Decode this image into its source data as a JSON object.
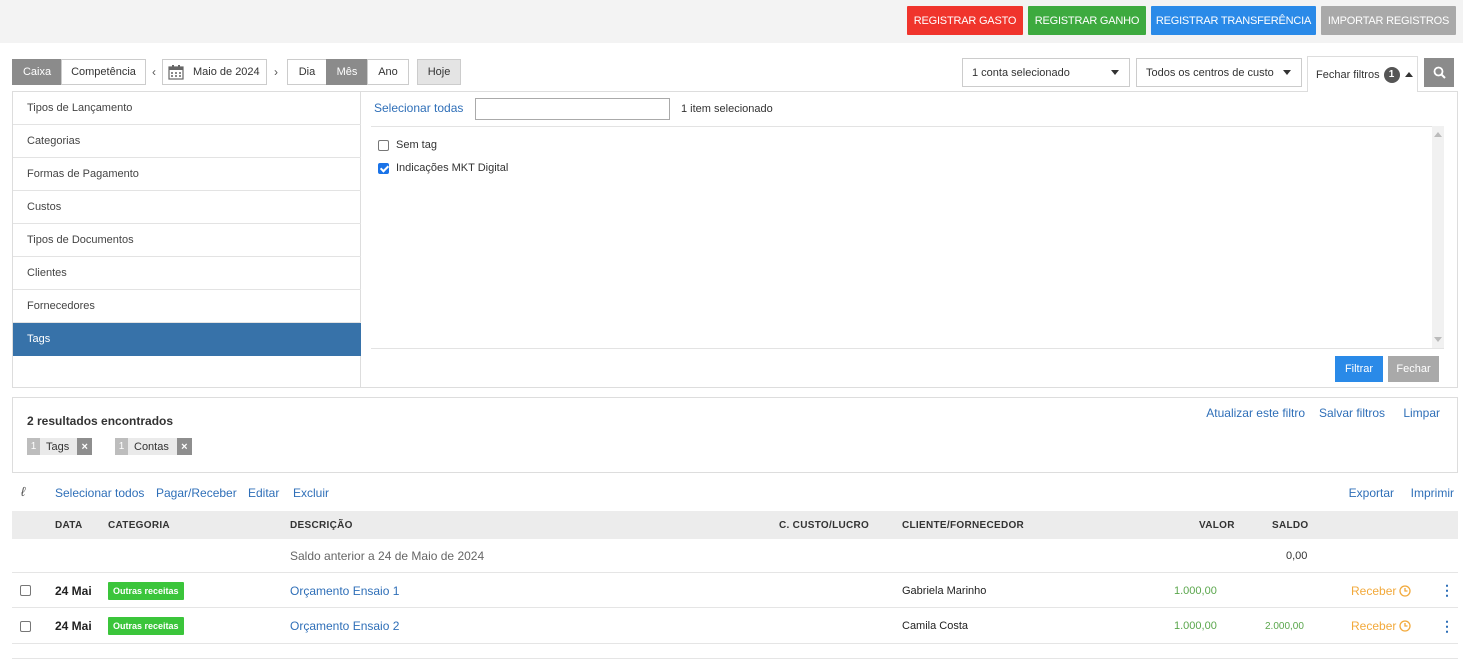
{
  "topbar": {
    "buttons": [
      {
        "label": "REGISTRAR GASTO",
        "color": "#f0342c"
      },
      {
        "label": "REGISTRAR GANHO",
        "color": "#3daa3f"
      },
      {
        "label": "REGISTRAR TRANSFERÊNCIA",
        "color": "#2a8ae8"
      },
      {
        "label": "IMPORTAR REGISTROS",
        "color": "#a9a9a9"
      }
    ]
  },
  "controls": {
    "mode": {
      "caixa": "Caixa",
      "competencia": "Competência"
    },
    "prev_icon": "chevron-left-icon",
    "calendar_icon": "calendar-icon",
    "period": "Maio de 2024",
    "next_icon": "chevron-right-icon",
    "granularity": {
      "dia": "Dia",
      "mes": "Mês",
      "ano": "Ano"
    },
    "today": "Hoje",
    "account_select": "1 conta selecionado",
    "cost_center_select": "Todos os centros de custo",
    "close_filters": "Fechar filtros",
    "filter_count": "1",
    "search_icon": "search-icon"
  },
  "filters": {
    "categories": [
      {
        "label": "Tipos de Lançamento",
        "active": false
      },
      {
        "label": "Categorias",
        "active": false
      },
      {
        "label": "Formas de Pagamento",
        "active": false
      },
      {
        "label": "Custos",
        "active": false
      },
      {
        "label": "Tipos de Documentos",
        "active": false
      },
      {
        "label": "Clientes",
        "active": false
      },
      {
        "label": "Fornecedores",
        "active": false
      },
      {
        "label": "Tags",
        "active": true
      }
    ],
    "select_all": "Selecionar todas",
    "search_value": "",
    "selected_count": "1 item selecionado",
    "options": [
      {
        "label": "Sem tag",
        "checked": false
      },
      {
        "label": "Indicações MKT Digital",
        "checked": true
      }
    ],
    "apply": "Filtrar",
    "close": "Fechar"
  },
  "results": {
    "count_text": "2 resultados encontrados",
    "chips": [
      {
        "count": "1",
        "label": "Tags"
      },
      {
        "count": "1",
        "label": "Contas"
      }
    ],
    "actions": {
      "update": "Atualizar este filtro",
      "save": "Salvar filtros",
      "clear": "Limpar"
    }
  },
  "toolbar": {
    "link_icon": "paperclip-icon",
    "select_all": "Selecionar todos",
    "pay_receive": "Pagar/Receber",
    "edit": "Editar",
    "delete": "Excluir",
    "export": "Exportar",
    "print": "Imprimir"
  },
  "table": {
    "headers": {
      "date": "DATA",
      "category": "CATEGORIA",
      "description": "DESCRIÇÃO",
      "cost_center": "C. CUSTO/LUCRO",
      "client": "CLIENTE/FORNECEDOR",
      "value": "VALOR",
      "balance": "SALDO"
    },
    "previous_balance": {
      "label": "Saldo anterior a 24 de Maio de 2024",
      "value": "0,00"
    },
    "rows": [
      {
        "date": "24 Mai",
        "category": "Outras receitas",
        "description": "Orçamento Ensaio 1",
        "cost_center": "",
        "client": "Gabriela Marinho",
        "value": "1.000,00",
        "balance": "",
        "action": "Receber"
      },
      {
        "date": "24 Mai",
        "category": "Outras receitas",
        "description": "Orçamento Ensaio 2",
        "cost_center": "",
        "client": "Camila Costa",
        "value": "1.000,00",
        "balance": "2.000,00",
        "action": "Receber"
      }
    ]
  }
}
